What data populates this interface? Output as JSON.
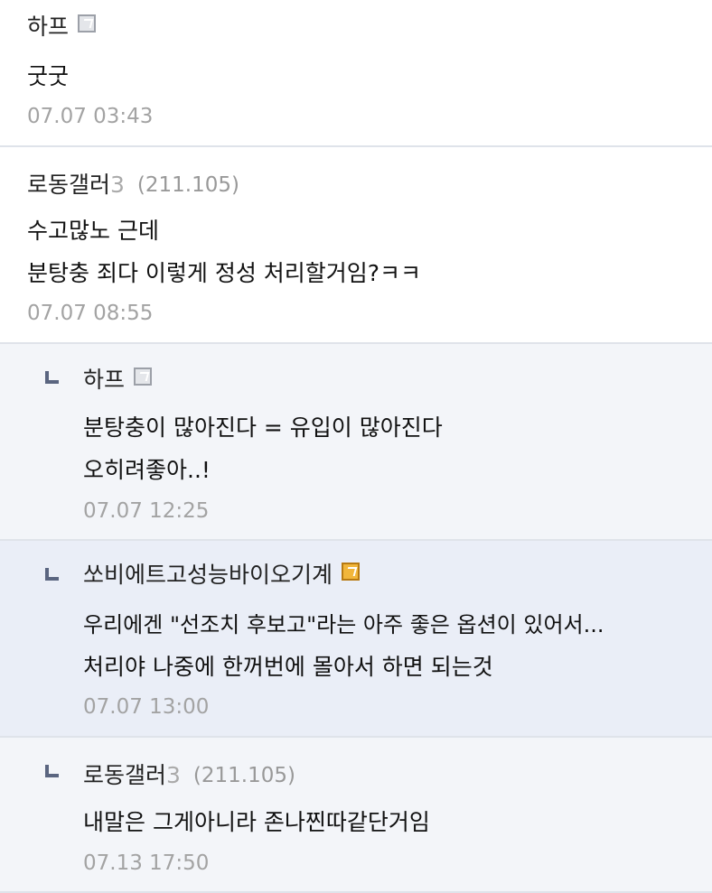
{
  "comments": [
    {
      "nick": "하프",
      "nick_suffix": "",
      "ip": "",
      "icon": "gallog-icon-gray",
      "lines": [
        "굿굿"
      ],
      "date": "07.07 03:43"
    },
    {
      "nick": "로동갤러",
      "nick_suffix": "3",
      "ip": "(211.105)",
      "icon": "",
      "lines": [
        "수고많노 근데",
        "분탕충 죄다 이렇게 정성 처리할거임?ㅋㅋ"
      ],
      "date": "07.07 08:55"
    }
  ],
  "replies": [
    {
      "nick": "하프",
      "nick_suffix": "",
      "ip": "",
      "icon": "gallog-icon-gray",
      "lines": [
        "분탕충이 많아진다 = 유입이 많아진다",
        "오히려좋아..!"
      ],
      "date": "07.07 12:25"
    },
    {
      "nick": "쏘비에트고성능바이오기계",
      "nick_suffix": "",
      "ip": "",
      "icon": "gallog-icon-gold",
      "lines": [
        "우리에겐 \"선조치 후보고\"라는 아주 좋은 옵션이 있어서...",
        "처리야 나중에 한꺼번에 몰아서 하면 되는것"
      ],
      "date": "07.07 13:00"
    },
    {
      "nick": "로동갤러",
      "nick_suffix": "3",
      "ip": "(211.105)",
      "icon": "",
      "lines": [
        "내말은 그게아니라 존나찐따같단거임"
      ],
      "date": "07.13 17:50"
    }
  ]
}
